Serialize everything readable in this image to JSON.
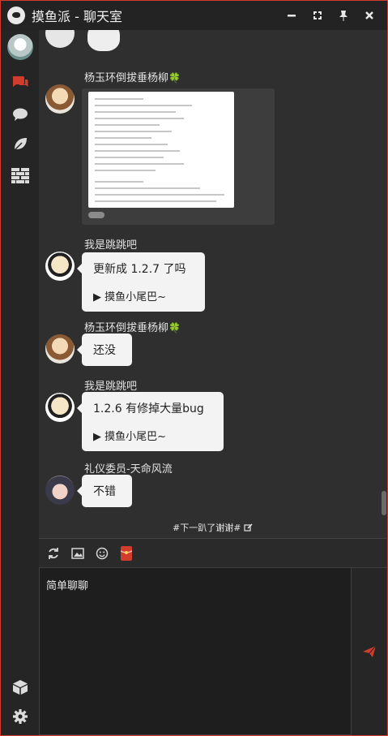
{
  "app": {
    "brand": "摸鱼派",
    "separator": " - ",
    "window_title": "聊天室"
  },
  "window_controls": [
    "minimize",
    "restore",
    "pin",
    "close"
  ],
  "sidebar": {
    "items": [
      {
        "name": "user-avatar"
      },
      {
        "name": "chatroom",
        "active": true
      },
      {
        "name": "private-chat"
      },
      {
        "name": "leaf"
      },
      {
        "name": "wall"
      }
    ],
    "bottom_items": [
      {
        "name": "package"
      },
      {
        "name": "settings"
      }
    ]
  },
  "messages": [
    {
      "nickname": "杨玉环倒拔垂杨柳",
      "badge": "🍀",
      "type": "image"
    },
    {
      "nickname": "我是跳跳吧",
      "type": "text",
      "text": "更新成 1.2.7 了吗",
      "tail": "▶ 摸鱼小尾巴~"
    },
    {
      "nickname": "杨玉环倒拔垂杨柳",
      "badge": "🍀",
      "type": "text",
      "text": "还没"
    },
    {
      "nickname": "我是跳跳吧",
      "type": "text",
      "text": "1.2.6 有修掉大量bug",
      "tail": "▶ 摸鱼小尾巴~"
    },
    {
      "nickname": "礼仪委员-天命风流",
      "type": "text",
      "text": "不错"
    }
  ],
  "topic": {
    "text": "#下一趴了谢谢#"
  },
  "input": {
    "value": "简单聊聊"
  },
  "colors": {
    "accent": "#d23c2c",
    "badge": "#3aa84b"
  }
}
